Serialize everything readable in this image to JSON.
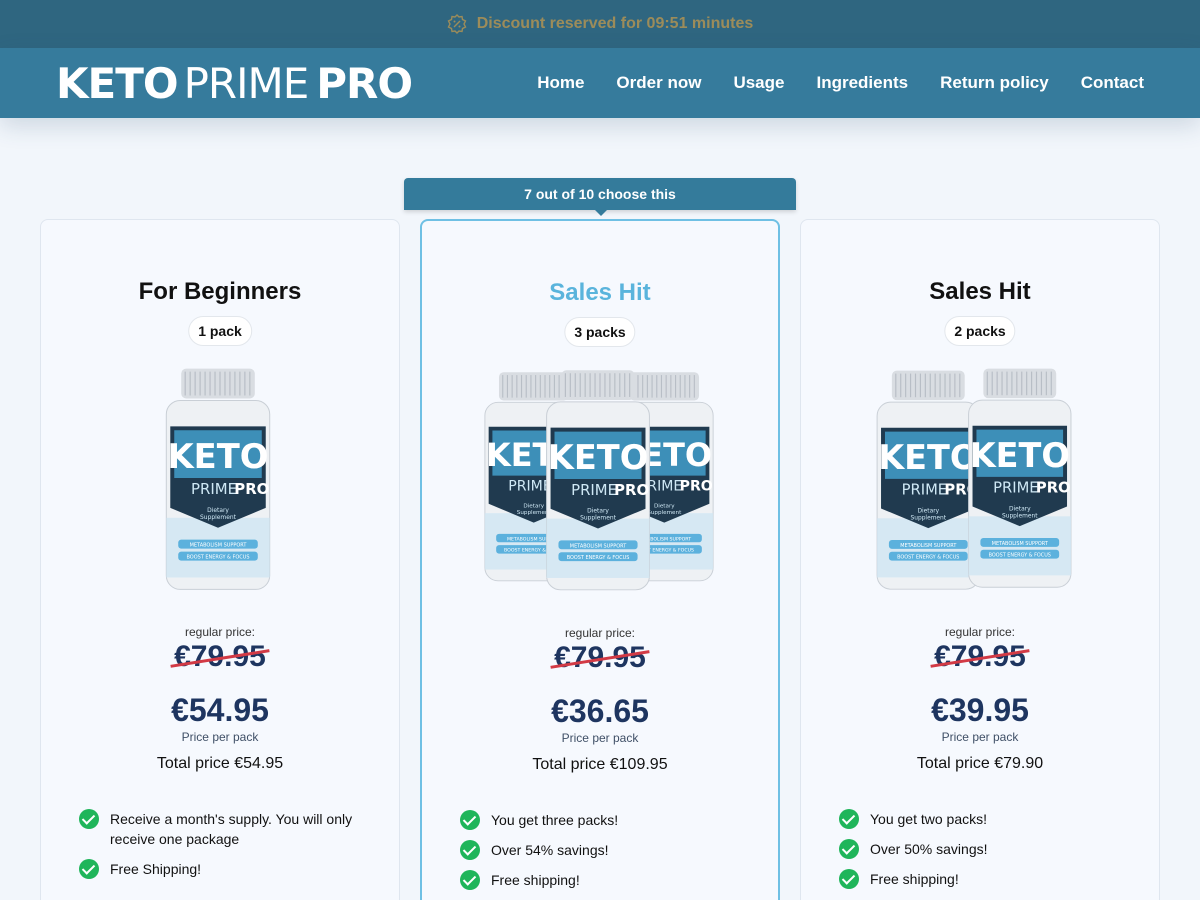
{
  "topbar": {
    "icon": "discount-tag-icon",
    "text": "Discount reserved for 09:51 minutes"
  },
  "header": {
    "logo": {
      "part1": "KETO",
      "part2": "PRIME",
      "part3": "PRO"
    },
    "nav": [
      "Home",
      "Order now",
      "Usage",
      "Ingredients",
      "Return policy",
      "Contact"
    ]
  },
  "popular_label": "7 out of 10 choose this",
  "cards": [
    {
      "title": "For Beginners",
      "packs": "1 pack",
      "regular_label": "regular price:",
      "old_price": "€79.95",
      "price": "€54.95",
      "per_pack": "Price per pack",
      "total": "Total price €54.95",
      "features": [
        "Receive a month's supply. You will only receive one package",
        "Free Shipping!"
      ]
    },
    {
      "title": "Sales Hit",
      "packs": "3 packs",
      "regular_label": "regular price:",
      "old_price": "€79.95",
      "price": "€36.65",
      "per_pack": "Price per pack",
      "total": "Total price €109.95",
      "features": [
        "You get three packs!",
        "Over 54% savings!",
        "Free shipping!"
      ]
    },
    {
      "title": "Sales Hit",
      "packs": "2 packs",
      "regular_label": "regular price:",
      "old_price": "€79.95",
      "price": "€39.95",
      "per_pack": "Price per pack",
      "total": "Total price €79.90",
      "features": [
        "You get two packs!",
        "Over 50% savings!",
        "Free shipping!"
      ]
    }
  ],
  "bottle_label": {
    "brand1": "KETO",
    "brand2": "PRIME",
    "brand3": "PRO",
    "line1": "Dietary",
    "line2": "Supplement",
    "band1": "METABOLISM SUPPORT",
    "band2": "BOOST ENERGY & FOCUS"
  },
  "colors": {
    "topbar": "#2f6680",
    "header": "#367b9c",
    "accent": "#5ab4dc",
    "price": "#1e3560",
    "strike": "#d23a45",
    "check": "#1fb55a"
  }
}
